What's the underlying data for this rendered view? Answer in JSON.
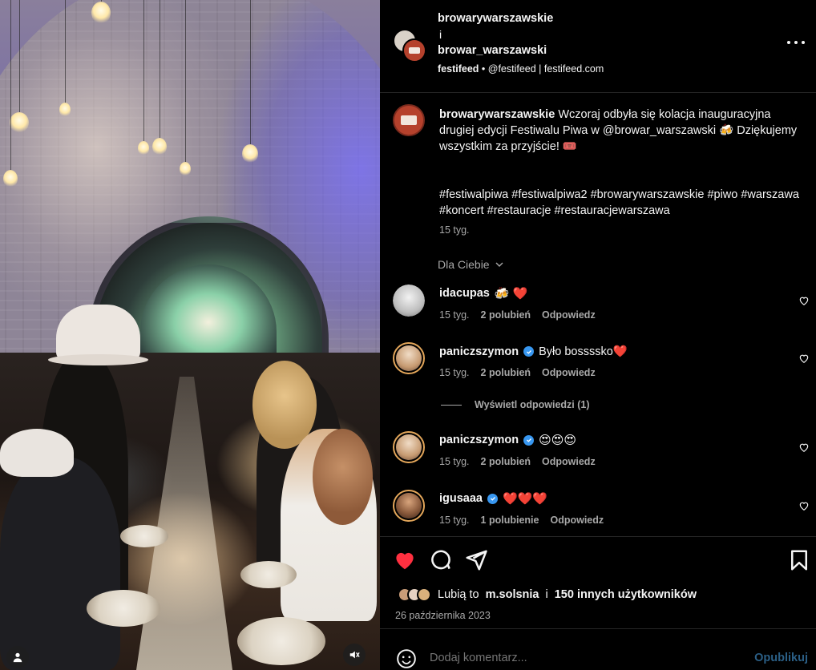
{
  "header": {
    "account_1": "browarywarszawskie",
    "joiner": "i",
    "account_2": "browar_warszawski",
    "sub_account": "festifeed",
    "sub_separator": "•",
    "sub_text": "@festifeed | festifeed.com"
  },
  "caption": {
    "username": "browarywarszawskie",
    "text": "Wczoraj odbyła się kolacja inauguracyjna drugiej edycji Festiwalu Piwa w @browar_warszawski 🍻 Dziękujemy wszystkim za przyjście! 🎟️",
    "tags": "#festiwalpiwa #festiwalpiwa2 #browarywarszawskie #piwo #warszawa #koncert #restauracje #restauracjewarszawa",
    "time": "15 tyg."
  },
  "filter_label": "Dla Ciebie",
  "comments": [
    {
      "username": "idacupas",
      "verified": false,
      "text": "🍻 ❤️",
      "time": "15 tyg.",
      "likes": "2 polubień",
      "reply": "Odpowiedz",
      "avatar_color": "#d9d9d9"
    },
    {
      "username": "paniczszymon",
      "verified": true,
      "text": "Było bossssko❤️",
      "time": "15 tyg.",
      "likes": "2 polubień",
      "reply": "Odpowiedz",
      "avatar_color": "#e2c9b0"
    },
    {
      "username": "paniczszymon",
      "verified": true,
      "text": "😍😍😍",
      "time": "15 tyg.",
      "likes": "2 polubień",
      "reply": "Odpowiedz",
      "avatar_color": "#e2c9b0"
    },
    {
      "username": "igusaaa",
      "verified": true,
      "text": "❤️❤️❤️",
      "time": "15 tyg.",
      "likes": "1 polubienie",
      "reply": "Odpowiedz",
      "avatar_color": "#8a5a3c"
    }
  ],
  "view_replies": "Wyświetl odpowiedzi (1)",
  "likes": {
    "prefix": "Lubią to",
    "user": "m.solsnia",
    "middle": "i",
    "others": "150 innych użytkowników"
  },
  "date": "26 października 2023",
  "add_comment": {
    "placeholder": "Dodaj komentarz...",
    "publish": "Opublikuj"
  },
  "colors": {
    "like_red": "#ff3040",
    "verified_blue": "#3897f0",
    "muted_text": "#a8a8a8",
    "publish_blue": "#2b5f86"
  },
  "icons": [
    "more-icon",
    "chevron-down-icon",
    "heart-outline-icon",
    "verified-icon",
    "heart-filled-icon",
    "comment-icon",
    "share-icon",
    "bookmark-icon",
    "smile-icon",
    "user-tag-icon",
    "mute-icon"
  ]
}
